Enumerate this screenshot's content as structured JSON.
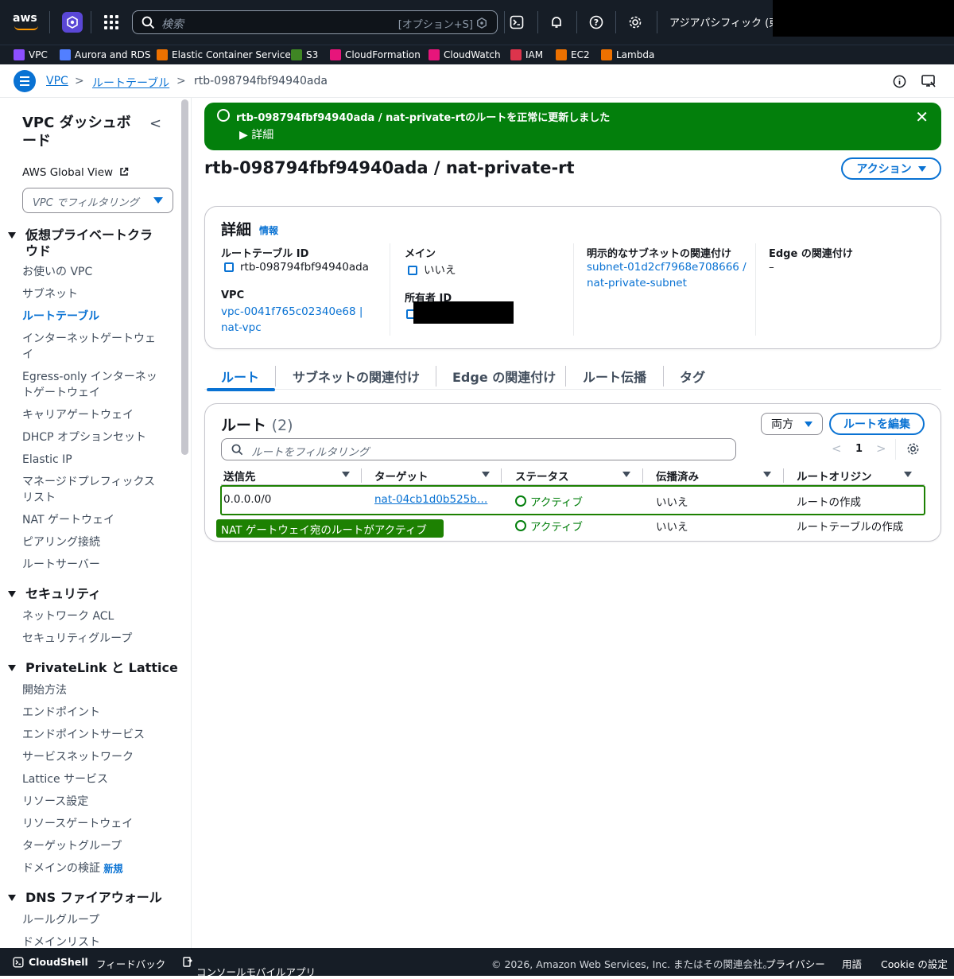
{
  "topbar": {
    "logo_text": "aws",
    "search_placeholder": "検索",
    "search_shortcut": "[オプション+S]",
    "region": "アジアパシフィック (東京)"
  },
  "favorites": [
    {
      "label": "VPC",
      "color": "#8c4fff"
    },
    {
      "label": "Aurora and RDS",
      "color": "#527fff"
    },
    {
      "label": "Elastic Container Service",
      "color": "#ed7100"
    },
    {
      "label": "S3",
      "color": "#3f8624"
    },
    {
      "label": "CloudFormation",
      "color": "#e7157b"
    },
    {
      "label": "CloudWatch",
      "color": "#e7157b"
    },
    {
      "label": "IAM",
      "color": "#dd344c"
    },
    {
      "label": "EC2",
      "color": "#ed7100"
    },
    {
      "label": "Lambda",
      "color": "#ed7100"
    }
  ],
  "breadcrumb": {
    "items": [
      "VPC",
      "ルートテーブル",
      "rtb-098794fbf94940ada"
    ],
    "sep": ">"
  },
  "sidebar": {
    "title": "VPC ダッシュボード",
    "collapse": "<",
    "global_view": "AWS Global View",
    "filter_placeholder": "VPC でフィルタリング",
    "sections": [
      {
        "title": "仮想プライベートクラウド",
        "items": [
          "お使いの VPC",
          "サブネット",
          "ルートテーブル",
          "インターネットゲートウェイ",
          "Egress-only インターネットゲートウェイ",
          "キャリアゲートウェイ",
          "DHCP オプションセット",
          "Elastic IP",
          "マネージドプレフィックスリスト",
          "NAT ゲートウェイ",
          "ピアリング接続",
          "ルートサーバー"
        ]
      },
      {
        "title": "セキュリティ",
        "items": [
          "ネットワーク ACL",
          "セキュリティグループ"
        ]
      },
      {
        "title": "PrivateLink と Lattice",
        "items": [
          "開始方法",
          "エンドポイント",
          "エンドポイントサービス",
          "サービスネットワーク",
          "Lattice サービス",
          "リソース設定",
          "リソースゲートウェイ",
          "ターゲットグループ",
          "ドメインの検証"
        ]
      },
      {
        "title": "DNS ファイアウォール",
        "items": [
          "ルールグループ",
          "ドメインリスト"
        ]
      }
    ],
    "new_badge": "新規"
  },
  "flash": {
    "message": "rtb-098794fbf94940ada / nat-private-rtのルートを正常に更新しました",
    "details": "詳細",
    "close": "✕"
  },
  "page": {
    "title": "rtb-098794fbf94940ada / nat-private-rt",
    "actions_label": "アクション"
  },
  "details": {
    "heading": "詳細",
    "info": "情報",
    "rtb_id_label": "ルートテーブル ID",
    "rtb_id": "rtb-098794fbf94940ada",
    "vpc_label": "VPC",
    "vpc_line1": "vpc-0041f765c02340e68 |",
    "vpc_line2": "nat-vpc",
    "main_label": "メイン",
    "main_value": "いいえ",
    "owner_label": "所有者 ID",
    "subnet_assoc_label": "明示的なサブネットの関連付け",
    "subnet_line1": "subnet-01d2cf7968e708666 /",
    "subnet_line2": "nat-private-subnet",
    "edge_label": "Edge の関連付け",
    "edge_value": "–"
  },
  "tabs": [
    "ルート",
    "サブネットの関連付け",
    "Edge の関連付け",
    "ルート伝播",
    "タグ"
  ],
  "routes": {
    "title": "ルート",
    "count": "(2)",
    "dropdown": "両方",
    "edit_button": "ルートを編集",
    "filter_placeholder": "ルートをフィルタリング",
    "page_number": "1",
    "columns": [
      "送信先",
      "ターゲット",
      "ステータス",
      "伝播済み",
      "ルートオリジン"
    ],
    "rows": [
      {
        "dest": "0.0.0.0/0",
        "target": "nat-04cb1d0b525b…",
        "status": "アクティブ",
        "propagated": "いいえ",
        "origin": "ルートの作成"
      },
      {
        "dest": "",
        "target": "",
        "status": "アクティブ",
        "propagated": "いいえ",
        "origin": "ルートテーブルの作成"
      }
    ],
    "annotation": "NAT ゲートウェイ宛のルートがアクティブ",
    "highlight_color": "#1d8102"
  },
  "footer": {
    "cloudshell": "CloudShell",
    "feedback": "フィードバック",
    "mobile": "コンソールモバイルアプリ",
    "copyright": "© 2026, Amazon Web Services, Inc. またはその関連会社。",
    "privacy": "プライバシー",
    "terms": "用語",
    "cookie": "Cookie の設定"
  }
}
